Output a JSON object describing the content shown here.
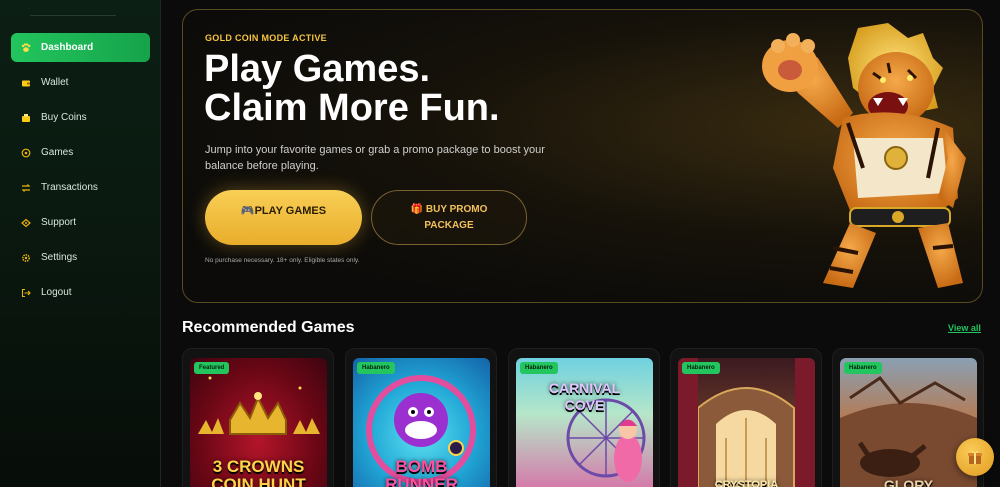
{
  "sidebar": {
    "items": [
      {
        "label": "Dashboard",
        "icon": "paw-icon",
        "active": true
      },
      {
        "label": "Wallet",
        "icon": "wallet-icon",
        "active": false
      },
      {
        "label": "Buy Coins",
        "icon": "coins-icon",
        "active": false
      },
      {
        "label": "Games",
        "icon": "gamepad-icon",
        "active": false
      },
      {
        "label": "Transactions",
        "icon": "transactions-icon",
        "active": false
      },
      {
        "label": "Support",
        "icon": "support-icon",
        "active": false
      },
      {
        "label": "Settings",
        "icon": "gear-icon",
        "active": false
      },
      {
        "label": "Logout",
        "icon": "logout-icon",
        "active": false
      }
    ]
  },
  "hero": {
    "tag": "GOLD COIN MODE ACTIVE",
    "title_line1": "Play Games.",
    "title_line2": "Claim More Fun.",
    "description": "Jump into your favorite games or grab a promo package to boost your balance before playing.",
    "play_button": "🎮PLAY GAMES",
    "promo_button_line1": "🎁 BUY PROMO",
    "promo_button_line2": "PACKAGE",
    "note": "No purchase necessary. 18+ only. Eligible states only."
  },
  "recommended": {
    "title": "Recommended Games",
    "view_all": "View all",
    "games": [
      {
        "badge": "Featured",
        "name_line1": "3 CROWNS",
        "name_line2": "COIN HUNT"
      },
      {
        "badge": "Habanero",
        "name_line1": "BOMB",
        "name_line2": "RUNNER"
      },
      {
        "badge": "Habanero",
        "name_line1": "CARNIVAL",
        "name_line2": "COVE"
      },
      {
        "badge": "Habanero",
        "name_line1": "CRYSTOPIA",
        "name_line2": ""
      },
      {
        "badge": "Habanero",
        "name_line1": "GLORY",
        "name_line2": ""
      }
    ]
  },
  "colors": {
    "accent_green": "#22c55e",
    "gold": "#f5c542"
  },
  "floating": {
    "icon": "gift-icon"
  }
}
